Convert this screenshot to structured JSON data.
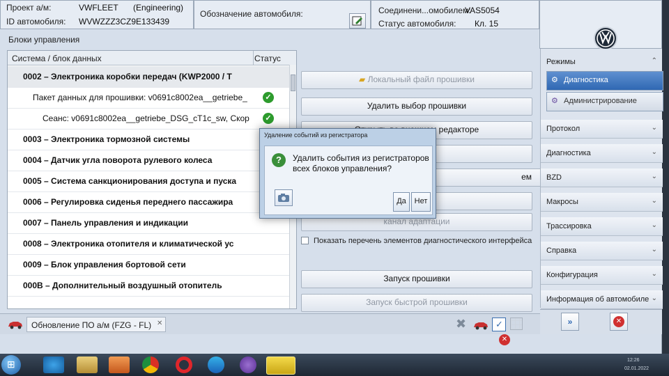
{
  "header": {
    "project_label": "Проект а/м:",
    "project_value": "VWFLEET",
    "project_mode": "(Engineering)",
    "vin_label": "ID автомобиля:",
    "vin_value": "WVWZZZ3CZ9E133439",
    "designation_label": "Обозначение автомобиля:",
    "connection_label": "Соединени...омобилем:",
    "connection_value": "VAS5054",
    "status_label": "Статус автомобиля:",
    "status_value": "Кл. 15"
  },
  "panel_title": "Блоки управления",
  "tree": {
    "col_system": "Система / блок данных",
    "col_status": "Статус",
    "rows": [
      {
        "text": "0002 – Электроника коробки передач  (KWP2000 / T",
        "bold": true
      },
      {
        "text": "Пакет данных для прошивки: v0691c8002ea__getriebe_",
        "bold": false
      },
      {
        "text": "Сеанс: v0691c8002ea__getriebe_DSG_cT1c_sw, Скор",
        "bold": false
      },
      {
        "text": "0003 – Электроника тормозной системы",
        "bold": true
      },
      {
        "text": "0004 – Датчик угла поворота рулевого колеса",
        "bold": true
      },
      {
        "text": "0005 – Система санкционирования доступа и пуска",
        "bold": true
      },
      {
        "text": "0006 – Регулировка сиденья переднего пассажира",
        "bold": true
      },
      {
        "text": "0007 – Панель управления и индикации",
        "bold": true
      },
      {
        "text": "0008 – Электроника отопителя и климатической ус",
        "bold": true
      },
      {
        "text": "0009 – Блок управления бортовой сети",
        "bold": true
      },
      {
        "text": "000B – Дополнительный воздушный отопитель",
        "bold": true
      }
    ]
  },
  "actions": {
    "local_file": "Локальный файл прошивки",
    "remove_selection": "Удалить выбор прошивки",
    "open_editor": "Открыть во внешнем редакторе",
    "partial_em": "ем",
    "adaptation": "канал адаптации",
    "show_list_checkbox": "Показать перечень элементов диагностического интерфейса",
    "start_flash": "Запуск прошивки",
    "start_quick_flash": "Запуск быстрой прошивки"
  },
  "dialog": {
    "title": "Удаление событий из регистратора",
    "message": "Удалить события из регистраторов всех блоков управления?",
    "yes": "Да",
    "no": "Нет"
  },
  "sidebar": {
    "modes_label": "Режимы",
    "diagnostics_mode": "Диагностика",
    "admin_mode": "Администрирование",
    "sections": [
      "Протокол",
      "Диагностика",
      "BZD",
      "Макросы",
      "Трассировка",
      "Справка",
      "Конфигурация",
      "Информация об автомобиле"
    ]
  },
  "bottom_tab": "Обновление ПО а/м (FZG - FL)",
  "tray": {
    "time": "12:26",
    "date": "02.01.2022"
  },
  "colors": {
    "accent": "#3a6fb0",
    "ok_green": "#2d9b2d",
    "close_red": "#d03030"
  }
}
